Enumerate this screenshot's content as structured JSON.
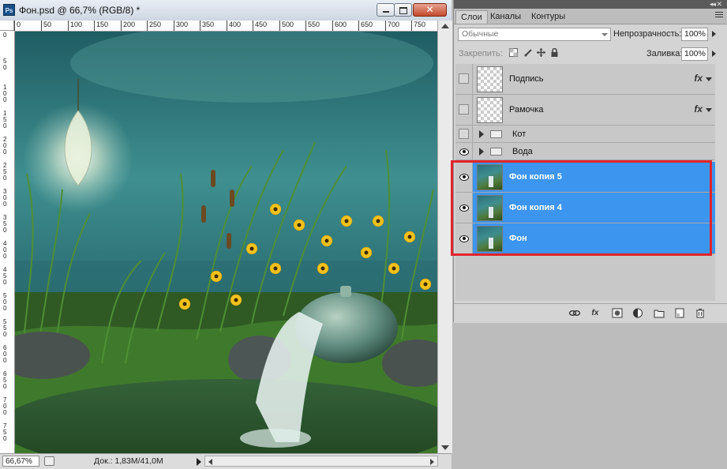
{
  "document": {
    "title": "Фон.psd @ 66,7% (RGB/8) *",
    "ps_badge": "Ps",
    "close_label": "✕",
    "ruler_h": [
      "0",
      "50",
      "100",
      "150",
      "200",
      "250",
      "300",
      "350",
      "400",
      "450",
      "500",
      "550",
      "600",
      "650",
      "700",
      "750"
    ],
    "ruler_v": [
      "0",
      "50",
      "100",
      "150",
      "200",
      "250",
      "300",
      "350",
      "400",
      "450",
      "500",
      "550",
      "600",
      "650",
      "700",
      "750"
    ],
    "zoom": "66,67%",
    "doc_info": "Док.: 1,83M/41,0M"
  },
  "panel": {
    "tabs": [
      "Слои",
      "Каналы",
      "Контуры"
    ],
    "blend_mode": "Обычные",
    "opacity_label": "Непрозрачность:",
    "opacity_value": "100%",
    "lock_label": "Закрепить:",
    "fill_label": "Заливка:",
    "fill_value": "100%",
    "layers": [
      {
        "name": "Подпись",
        "type": "effect",
        "visible": false,
        "selected": false
      },
      {
        "name": "Рамочка",
        "type": "effect",
        "visible": false,
        "selected": false
      },
      {
        "name": "Кот",
        "type": "group",
        "visible": false,
        "selected": false
      },
      {
        "name": "Вода",
        "type": "group",
        "visible": true,
        "selected": false
      },
      {
        "name": "Фон копия 5",
        "type": "image",
        "visible": true,
        "selected": true
      },
      {
        "name": "Фон копия 4",
        "type": "image",
        "visible": true,
        "selected": true
      },
      {
        "name": "Фон",
        "type": "image",
        "visible": true,
        "selected": true
      }
    ],
    "fx_label": "fx",
    "footer_icons": [
      "link-icon",
      "fx-icon",
      "mask-icon",
      "adjustment-icon",
      "group-folder-icon",
      "new-layer-icon",
      "trash-icon"
    ]
  },
  "colors": {
    "selection": "#3c95ef",
    "highlight_frame": "#e2242a"
  }
}
